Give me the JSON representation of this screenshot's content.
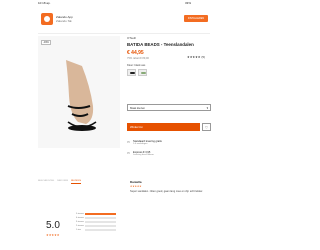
{
  "status": {
    "time": "10:18 ap.",
    "battery": "33%"
  },
  "banner": {
    "title": "Zalando App",
    "subtitle": "Zalando SE",
    "install": "INSTALLEREN"
  },
  "product": {
    "image_tag": "-49%",
    "brand": "O'Neill",
    "name": "BATIDA BEADS - Teenslandalen",
    "price": "€ 44,95",
    "old_price": "75% rabatt  € 89,90",
    "stars_label": "★★★★★ (5)",
    "color_label": "Kleur: black ass",
    "size_select": "Maat kiezen",
    "add_to_cart": "Winkel inn",
    "usp": [
      {
        "title": "Standaard levering gratis",
        "sub": "1-4 werkdagen"
      },
      {
        "title": "Express € 3,95",
        "sub": "Levering beschikbaar"
      }
    ]
  },
  "reviews": {
    "tabs": [
      "BESCHRIJVING",
      "PASVORM",
      "REVIEWS"
    ],
    "active_tab": 2,
    "score": "5.0",
    "score_stars": "★★★★★",
    "bars": [
      {
        "label": "5 sterren",
        "fill": 1.0
      },
      {
        "label": "4 sterren",
        "fill": 0.0
      },
      {
        "label": "3 sterren",
        "fill": 0.0
      },
      {
        "label": "2 sterren",
        "fill": 0.0
      },
      {
        "label": "1 ster",
        "fill": 0.0
      }
    ],
    "first_review": {
      "name": "Daniella",
      "stars": "★★★★★",
      "text": "Super sandalen. zitten goed, gaan lang mee en zijn echt lekker."
    }
  },
  "colors": {
    "accent": "#e65100",
    "brand": "#f36c21"
  }
}
